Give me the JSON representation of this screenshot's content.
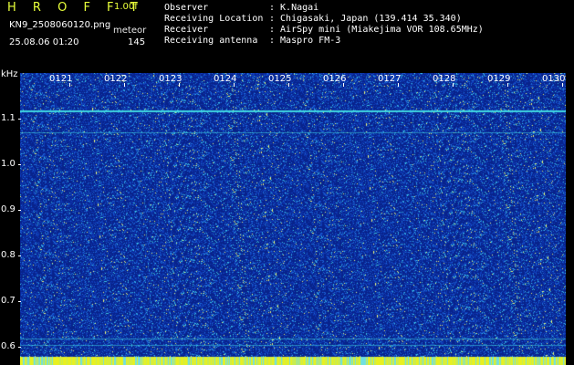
{
  "header": {
    "app_title": "H R O F F T",
    "version": "1.00f",
    "filename": "KN9_2508060120.png",
    "meteor_label": "meteor",
    "datetime": "25.08.06 01:20",
    "meteor_count": "145"
  },
  "info": [
    {
      "key": "Observer",
      "value": ": K.Nagai"
    },
    {
      "key": "Receiving Location",
      "value": ": Chigasaki, Japan (139.414 35.340)"
    },
    {
      "key": "Receiver",
      "value": ": AirSpy mini (Miakejima VOR 108.65MHz)"
    },
    {
      "key": "Receiving antenna",
      "value": ": Maspro FM-3"
    }
  ],
  "axis": {
    "y_unit": "kHz",
    "y_labels": [
      "1.1",
      "1.0",
      "0.9",
      "0.8",
      "0.7",
      "0.6"
    ],
    "time_labels": [
      "0121",
      "0122",
      "0123",
      "0124",
      "0125",
      "0126",
      "0127",
      "0128",
      "0129",
      "0130"
    ]
  },
  "colors": {
    "background": "#000000",
    "waterfall_base": "#0a2a9a",
    "title_yellow": "#e8ff3a",
    "signal_line": "#3fd6e0",
    "bottom_band": "#e8f020"
  }
}
